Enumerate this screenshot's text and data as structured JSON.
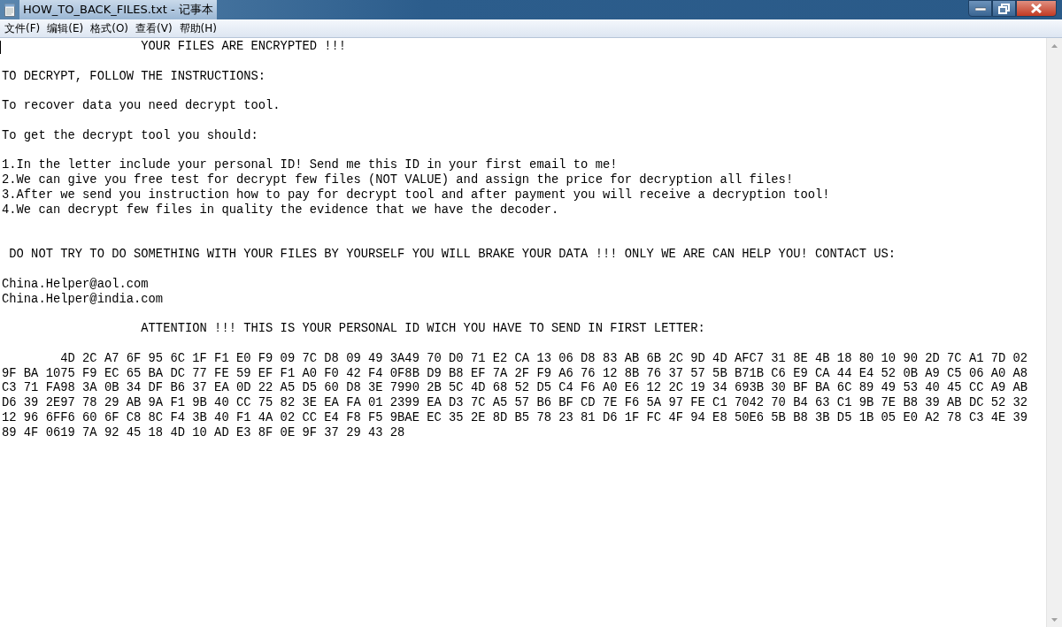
{
  "window": {
    "title": "HOW_TO_BACK_FILES.txt - 记事本"
  },
  "menu": [
    "文件(F)",
    "编辑(E)",
    "格式(O)",
    "查看(V)",
    "帮助(H)"
  ],
  "editor": {
    "lines": [
      {
        "kind": "line",
        "text": "                   YOUR FILES ARE ENCRYPTED !!!"
      },
      {
        "kind": "blank"
      },
      {
        "kind": "line",
        "text": "TO DECRYPT, FOLLOW THE INSTRUCTIONS:"
      },
      {
        "kind": "blank"
      },
      {
        "kind": "line",
        "text": "To recover data you need decrypt tool."
      },
      {
        "kind": "blank"
      },
      {
        "kind": "line",
        "text": "To get the decrypt tool you should:"
      },
      {
        "kind": "blank"
      },
      {
        "kind": "line",
        "text": "1.In the letter include your personal ID! Send me this ID in your first email to me!"
      },
      {
        "kind": "line",
        "text": "2.We can give you free test for decrypt few files (NOT VALUE) and assign the price for decryption all files!"
      },
      {
        "kind": "line",
        "text": "3.After we send you instruction how to pay for decrypt tool and after payment you will receive a decryption tool!"
      },
      {
        "kind": "line",
        "text": "4.We can decrypt few files in quality the evidence that we have the decoder."
      },
      {
        "kind": "blank"
      },
      {
        "kind": "blank"
      },
      {
        "kind": "line",
        "text": " DO NOT TRY TO DO SOMETHING WITH YOUR FILES BY YOURSELF YOU WILL BRAKE YOUR DATA !!! ONLY WE ARE CAN HELP YOU! CONTACT US:"
      },
      {
        "kind": "blank"
      },
      {
        "kind": "line",
        "text": "China.Helper@aol.com"
      },
      {
        "kind": "line",
        "text": "China.Helper@india.com"
      },
      {
        "kind": "blank"
      },
      {
        "kind": "line",
        "text": "                   ATTENTION !!! THIS IS YOUR PERSONAL ID WICH YOU HAVE TO SEND IN FIRST LETTER:"
      },
      {
        "kind": "blank"
      },
      {
        "kind": "line",
        "text": "        4D 2C A7 6F 95 6C 1F F1 E0 F9 09 7C D8 09 49 3A49 70 D0 71 E2 CA 13 06 D8 83 AB 6B 2C 9D 4D AFC7 31 8E 4B 18 80 10 90 2D 7C A1 7D 02"
      },
      {
        "kind": "line",
        "text": "9F BA 1075 F9 EC 65 BA DC 77 FE 59 EF F1 A0 F0 42 F4 0F8B D9 B8 EF 7A 2F F9 A6 76 12 8B 76 37 57 5B B71B C6 E9 CA 44 E4 52 0B A9 C5 06 A0 A8"
      },
      {
        "kind": "line",
        "text": "C3 71 FA98 3A 0B 34 DF B6 37 EA 0D 22 A5 D5 60 D8 3E 7990 2B 5C 4D 68 52 D5 C4 F6 A0 E6 12 2C 19 34 693B 30 BF BA 6C 89 49 53 40 45 CC A9 AB"
      },
      {
        "kind": "line",
        "text": "D6 39 2E97 78 29 AB 9A F1 9B 40 CC 75 82 3E EA FA 01 2399 EA D3 7C A5 57 B6 BF CD 7E F6 5A 97 FE C1 7042 70 B4 63 C1 9B 7E B8 39 AB DC 52 32"
      },
      {
        "kind": "line",
        "text": "12 96 6FF6 60 6F C8 8C F4 3B 40 F1 4A 02 CC E4 F8 F5 9BAE EC 35 2E 8D B5 78 23 81 D6 1F FC 4F 94 E8 50E6 5B B8 3B D5 1B 05 E0 A2 78 C3 4E 39"
      },
      {
        "kind": "line",
        "text": "89 4F 0619 7A 92 45 18 4D 10 AD E3 8F 0E 9F 37 29 43 28"
      }
    ]
  }
}
